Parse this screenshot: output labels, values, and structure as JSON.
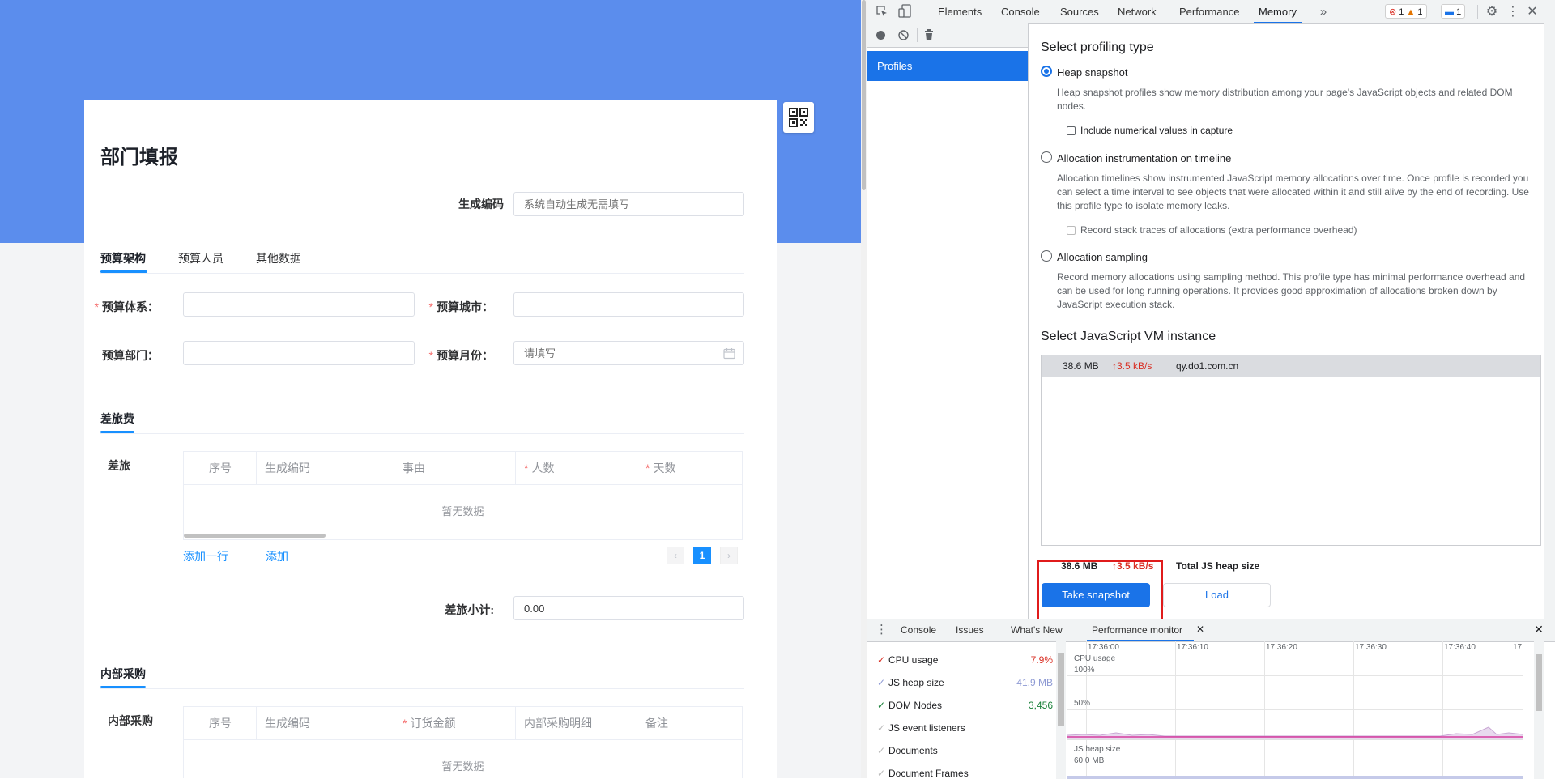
{
  "form": {
    "title": "部门填报",
    "code_label": "生成编码",
    "code_placeholder": "系统自动生成无需填写",
    "tabs": [
      "预算架构",
      "预算人员",
      "其他数据"
    ],
    "fields": {
      "system_label": "预算体系：",
      "city_label": "预算城市：",
      "dept_label": "预算部门：",
      "month_label": "预算月份：",
      "month_placeholder": "请填写",
      "required_mark": "*"
    },
    "travel": {
      "section_title": "差旅费",
      "row_label": "差旅",
      "columns": [
        "序号",
        "生成编码",
        "事由",
        "人数",
        "天数"
      ],
      "empty_text": "暂无数据",
      "add_row": "添加一行",
      "add": "添加",
      "current_page": "1",
      "subtotal_label": "差旅小计:",
      "subtotal_value": "0.00"
    },
    "purchase": {
      "section_title": "内部采购",
      "row_label": "内部采购",
      "columns": [
        "序号",
        "生成编码",
        "订货金额",
        "内部采购明细",
        "备注"
      ],
      "empty_text": "暂无数据"
    }
  },
  "devtools": {
    "tabs": [
      "Elements",
      "Console",
      "Sources",
      "Network",
      "Performance",
      "Memory"
    ],
    "active_tab": "Memory",
    "badges": {
      "errors": "1",
      "warnings": "1",
      "messages": "1"
    },
    "sidebar": {
      "profiles": "Profiles"
    },
    "memory": {
      "select_title": "Select profiling type",
      "options": [
        {
          "title": "Heap snapshot",
          "desc": "Heap snapshot profiles show memory distribution among your page's JavaScript objects and related DOM nodes.",
          "checkbox": "Include numerical values in capture"
        },
        {
          "title": "Allocation instrumentation on timeline",
          "desc": "Allocation timelines show instrumented JavaScript memory allocations over time. Once profile is recorded you can select a time interval to see objects that were allocated within it and still alive by the end of recording. Use this profile type to isolate memory leaks.",
          "checkbox": "Record stack traces of allocations (extra performance overhead)"
        },
        {
          "title": "Allocation sampling",
          "desc": "Record memory allocations using sampling method. This profile type has minimal performance overhead and can be used for long running operations. It provides good approximation of allocations broken down by JavaScript execution stack."
        }
      ],
      "vm_title": "Select JavaScript VM instance",
      "vm_row": {
        "size": "38.6 MB",
        "rate": "↑3.5 kB/s",
        "host": "qy.do1.com.cn"
      },
      "total": {
        "size": "38.6 MB",
        "rate": "↑3.5 kB/s",
        "label": "Total JS heap size"
      },
      "take_snapshot": "Take snapshot",
      "load": "Load"
    },
    "drawer": {
      "tabs": [
        "Console",
        "Issues",
        "What's New",
        "Performance monitor"
      ],
      "metrics": [
        {
          "name": "CPU usage",
          "value": "7.9%",
          "color": "#d93025",
          "checked": true
        },
        {
          "name": "JS heap size",
          "value": "41.9 MB",
          "color": "#8e9ad4",
          "checked": true
        },
        {
          "name": "DOM Nodes",
          "value": "3,456",
          "color": "#188038",
          "checked": true
        },
        {
          "name": "JS event listeners",
          "value": "",
          "color": "#9aa0a6",
          "checked": false
        },
        {
          "name": "Documents",
          "value": "",
          "color": "#9aa0a6",
          "checked": false
        },
        {
          "name": "Document Frames",
          "value": "",
          "color": "#9aa0a6",
          "checked": false
        }
      ],
      "times": [
        "17:36:00",
        "17:36:10",
        "17:36:20",
        "17:36:30",
        "17:36:40",
        "17:"
      ],
      "chart_labels": {
        "cpu": "CPU usage",
        "p100": "100%",
        "p50": "50%",
        "heap": "JS heap size",
        "heap_max": "60.0 MB"
      }
    }
  }
}
